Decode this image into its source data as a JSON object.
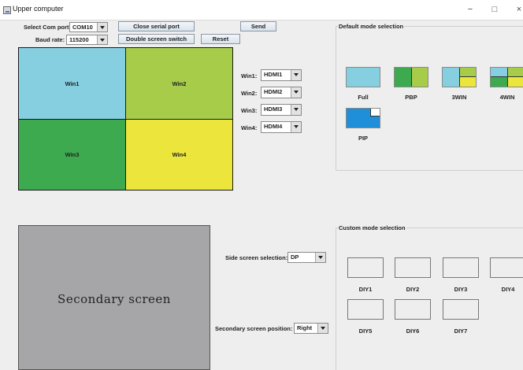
{
  "window": {
    "title": "Upper computer",
    "controls": {
      "minimize": "−",
      "maximize": "□",
      "close": "×"
    }
  },
  "serial": {
    "com_label": "Select Com port :",
    "com_value": "COM10",
    "baud_label": "Baud rate:",
    "baud_value": "115200",
    "close_port_button": "Close serial port",
    "send_button": "Send",
    "double_screen_button": "Double screen switch",
    "reset_button": "Reset"
  },
  "layout": {
    "windows": [
      {
        "label": "Win1",
        "color": "#86cfe0"
      },
      {
        "label": "Win2",
        "color": "#a6cc4a"
      },
      {
        "label": "Win3",
        "color": "#3daa4f"
      },
      {
        "label": "Win4",
        "color": "#ece63c"
      }
    ]
  },
  "sources": [
    {
      "label": "Win1:",
      "value": "HDMI1"
    },
    {
      "label": "Win2:",
      "value": "HDMI2"
    },
    {
      "label": "Win3:",
      "value": "HDMI3"
    },
    {
      "label": "Win4:",
      "value": "HDMI4"
    }
  ],
  "default_modes": {
    "title": "Default mode selection",
    "items": [
      {
        "label": "Full",
        "icon": "full-layout-icon"
      },
      {
        "label": "PBP",
        "icon": "pbp-layout-icon"
      },
      {
        "label": "3WIN",
        "icon": "3win-layout-icon"
      },
      {
        "label": "4WIN",
        "icon": "4win-layout-icon"
      },
      {
        "label": "PIP",
        "icon": "pip-layout-icon"
      }
    ]
  },
  "custom_modes": {
    "title": "Custom mode selection",
    "items": [
      "DIY1",
      "DIY2",
      "DIY3",
      "DIY4",
      "DIY5",
      "DIY6",
      "DIY7"
    ]
  },
  "side_screen": {
    "label": "Side screen selection:",
    "value": "DP",
    "position_label": "Secondary screen position:",
    "position_value": "Right"
  },
  "secondary_screen": {
    "label": "Secondary screen",
    "color": "#a6a6a8"
  },
  "colors": {
    "accent_blue": "#1e8fd8",
    "background": "#eeeeee"
  }
}
